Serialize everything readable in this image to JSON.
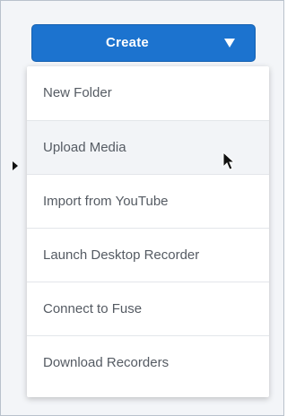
{
  "create_button": {
    "label": "Create",
    "icon": "caret-down-icon"
  },
  "menu": {
    "items": [
      {
        "label": "New Folder"
      },
      {
        "label": "Upload Media",
        "hovered": true
      },
      {
        "label": "Import from YouTube"
      },
      {
        "label": "Launch Desktop Recorder"
      },
      {
        "label": "Connect to Fuse"
      },
      {
        "label": "Download Recorders"
      }
    ]
  },
  "icons": {
    "expander": "left-arrow-icon",
    "pointer": "mouse-cursor-icon"
  },
  "colors": {
    "accent": "#1c73cf",
    "menu_background": "#ffffff",
    "menu_text": "#555b63",
    "hover_background": "#f2f4f7",
    "page_background": "#f3f5f8"
  }
}
